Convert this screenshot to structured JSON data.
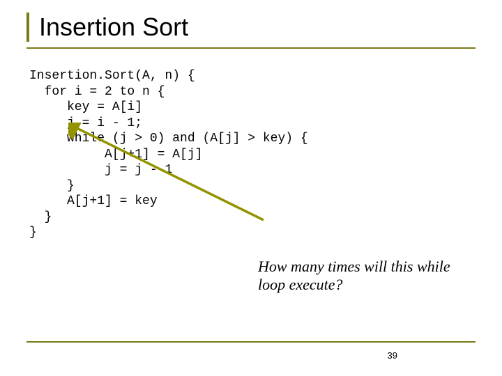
{
  "title": "Insertion Sort",
  "code": {
    "l1": "Insertion.Sort(A, n) {",
    "l2": "  for i = 2 to n {",
    "l3": "     key = A[i]",
    "l4": "     j = i - 1;",
    "l5": "     while (j > 0) and (A[j] > key) {",
    "l6": "          A[j+1] = A[j]",
    "l7": "          j = j - 1",
    "l8": "     }",
    "l9": "     A[j+1] = key",
    "l10": "  }",
    "l11": "}"
  },
  "question": "How many times will this while loop execute?",
  "page": "39"
}
